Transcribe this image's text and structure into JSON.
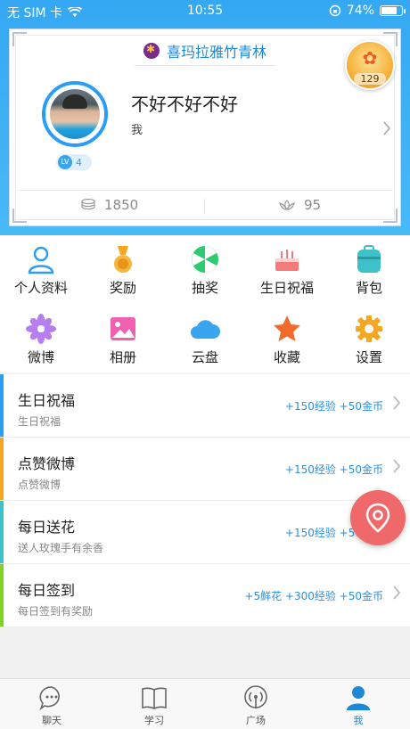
{
  "status_bar": {
    "carrier": "无 SIM 卡",
    "time": "10:55",
    "battery": "74%"
  },
  "profile": {
    "school": "喜玛拉雅竹青林",
    "nickname": "不好不好不好",
    "signature": "我",
    "level_badge": "LV",
    "level": "4",
    "flower_count": "129",
    "coins": "1850",
    "flowers": "95"
  },
  "grid": [
    {
      "label": "个人资料",
      "icon": "person-icon"
    },
    {
      "label": "奖励",
      "icon": "medal-icon"
    },
    {
      "label": "抽奖",
      "icon": "wheel-icon"
    },
    {
      "label": "生日祝福",
      "icon": "cake-icon"
    },
    {
      "label": "背包",
      "icon": "backpack-icon"
    },
    {
      "label": "微博",
      "icon": "flower-icon"
    },
    {
      "label": "相册",
      "icon": "photo-icon"
    },
    {
      "label": "云盘",
      "icon": "cloud-icon"
    },
    {
      "label": "收藏",
      "icon": "star-icon"
    },
    {
      "label": "设置",
      "icon": "gear-icon"
    }
  ],
  "tasks": [
    {
      "title": "生日祝福",
      "sub": "生日祝福",
      "reward": "+150经验 +50金币",
      "color": "#2a9df4"
    },
    {
      "title": "点赞微博",
      "sub": "点赞微博",
      "reward": "+150经验 +50金币",
      "color": "#f5a623"
    },
    {
      "title": "每日送花",
      "sub": "送人玫瑰手有余香",
      "reward": "+150经验 +50金币",
      "color": "#3fc1c9"
    },
    {
      "title": "每日签到",
      "sub": "每日签到有奖励",
      "reward": "+5鲜花 +300经验 +50金币",
      "color": "#7ed321"
    }
  ],
  "tabs": [
    {
      "label": "聊天",
      "icon": "chat-icon"
    },
    {
      "label": "学习",
      "icon": "book-icon"
    },
    {
      "label": "广场",
      "icon": "broadcast-icon"
    },
    {
      "label": "我",
      "icon": "me-icon"
    }
  ],
  "colors": {
    "accent": "#1e88d8",
    "header": "#34a8f2",
    "fab": "#f0696a"
  }
}
